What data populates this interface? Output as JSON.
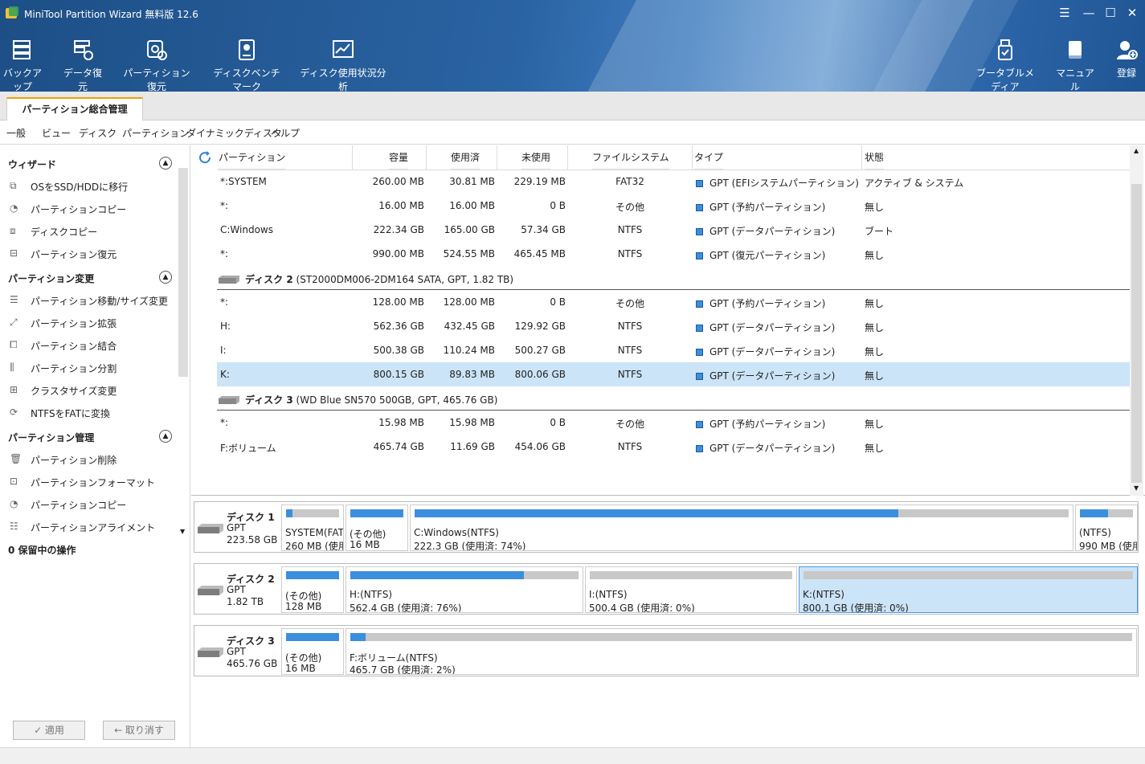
{
  "app": {
    "title": "MiniTool Partition Wizard 無料版 12.6"
  },
  "window_controls": {
    "menu": "☰",
    "minimize": "—",
    "maximize": "☐",
    "close": "✕"
  },
  "toolbar": {
    "left": [
      {
        "label": "バックアップ",
        "icon": "backup-icon"
      },
      {
        "label": "データ復元",
        "icon": "data-recovery-icon"
      },
      {
        "label": "パーティション復元",
        "icon": "partition-recovery-icon"
      },
      {
        "label": "ディスクベンチマーク",
        "icon": "disk-benchmark-icon"
      },
      {
        "label": "ディスク使用状況分析",
        "icon": "disk-usage-icon"
      }
    ],
    "right": [
      {
        "label": "ブータブルメディア",
        "icon": "bootable-media-icon"
      },
      {
        "label": "マニュアル",
        "icon": "manual-icon"
      },
      {
        "label": "登録",
        "icon": "register-icon"
      }
    ]
  },
  "tab": {
    "label": "パーティション総合管理"
  },
  "menu": [
    "一般",
    "ビュー",
    "ディスク",
    "パーティション",
    "ダイナミックディスク",
    "ヘルプ"
  ],
  "sidebar": {
    "sections": [
      {
        "title": "ウィザード",
        "items": [
          "OSをSSD/HDDに移行",
          "パーティションコピー",
          "ディスクコピー",
          "パーティション復元"
        ]
      },
      {
        "title": "パーティション変更",
        "items": [
          "パーティション移動/サイズ変更",
          "パーティション拡張",
          "パーティション結合",
          "パーティション分割",
          "クラスタサイズ変更",
          "NTFSをFATに変換"
        ]
      },
      {
        "title": "パーティション管理",
        "items": [
          "パーティション削除",
          "パーティションフォーマット",
          "パーティションコピー",
          "パーティションアライメント"
        ]
      }
    ],
    "pending": "0 保留中の操作",
    "apply": "✓ 適用",
    "undo": "← 取り消す"
  },
  "table": {
    "headers": [
      "パーティション",
      "容量",
      "使用済",
      "未使用",
      "ファイルシステム",
      "タイプ",
      "状態"
    ],
    "rows": [
      {
        "kind": "part",
        "name": "*:SYSTEM",
        "cap": "260.00 MB",
        "used": "30.81 MB",
        "free": "229.19 MB",
        "fs": "FAT32",
        "type": "GPT (EFIシステムパーティション)",
        "status": "アクティブ & システム"
      },
      {
        "kind": "part",
        "name": "*:",
        "cap": "16.00 MB",
        "used": "16.00 MB",
        "free": "0 B",
        "fs": "その他",
        "type": "GPT (予約パーティション)",
        "status": "無し"
      },
      {
        "kind": "part",
        "name": "C:Windows",
        "cap": "222.34 GB",
        "used": "165.00 GB",
        "free": "57.34 GB",
        "fs": "NTFS",
        "type": "GPT (データパーティション)",
        "status": "ブート"
      },
      {
        "kind": "part",
        "name": "*:",
        "cap": "990.00 MB",
        "used": "524.55 MB",
        "free": "465.45 MB",
        "fs": "NTFS",
        "type": "GPT (復元パーティション)",
        "status": "無し"
      },
      {
        "kind": "disk",
        "label": "ディスク 2",
        "detail": "(ST2000DM006-2DM164 SATA, GPT, 1.82 TB)"
      },
      {
        "kind": "part",
        "name": "*:",
        "cap": "128.00 MB",
        "used": "128.00 MB",
        "free": "0 B",
        "fs": "その他",
        "type": "GPT (予約パーティション)",
        "status": "無し"
      },
      {
        "kind": "part",
        "name": "H:",
        "cap": "562.36 GB",
        "used": "432.45 GB",
        "free": "129.92 GB",
        "fs": "NTFS",
        "type": "GPT (データパーティション)",
        "status": "無し"
      },
      {
        "kind": "part",
        "name": "I:",
        "cap": "500.38 GB",
        "used": "110.24 MB",
        "free": "500.27 GB",
        "fs": "NTFS",
        "type": "GPT (データパーティション)",
        "status": "無し"
      },
      {
        "kind": "part",
        "name": "K:",
        "cap": "800.15 GB",
        "used": "89.83 MB",
        "free": "800.06 GB",
        "fs": "NTFS",
        "type": "GPT (データパーティション)",
        "status": "無し",
        "selected": true
      },
      {
        "kind": "disk",
        "label": "ディスク 3",
        "detail": "(WD Blue SN570 500GB, GPT, 465.76 GB)"
      },
      {
        "kind": "part",
        "name": "*:",
        "cap": "15.98 MB",
        "used": "15.98 MB",
        "free": "0 B",
        "fs": "その他",
        "type": "GPT (予約パーティション)",
        "status": "無し"
      },
      {
        "kind": "part",
        "name": "F:ボリューム",
        "cap": "465.74 GB",
        "used": "11.69 GB",
        "free": "454.06 GB",
        "fs": "NTFS",
        "type": "GPT (データパーティション)",
        "status": "無し"
      }
    ]
  },
  "disks": [
    {
      "name": "ディスク 1",
      "type": "GPT",
      "size": "223.58 GB",
      "parts": [
        {
          "l1": "SYSTEM(FAT3",
          "l2": "260 MB (使用",
          "fill": 0.12
        },
        {
          "l1": "(その他)",
          "l2": "16 MB",
          "fill": 1.0
        },
        {
          "l1": "C:Windows(NTFS)",
          "l2": "222.3 GB (使用済: 74%)",
          "fill": 0.74
        },
        {
          "l1": "(NTFS)",
          "l2": "990 MB (使用",
          "fill": 0.53
        }
      ]
    },
    {
      "name": "ディスク 2",
      "type": "GPT",
      "size": "1.82 TB",
      "parts": [
        {
          "l1": "(その他)",
          "l2": "128 MB",
          "fill": 1.0
        },
        {
          "l1": "H:(NTFS)",
          "l2": "562.4 GB (使用済: 76%)",
          "fill": 0.76
        },
        {
          "l1": "I:(NTFS)",
          "l2": "500.4 GB (使用済: 0%)",
          "fill": 0.0
        },
        {
          "l1": "K:(NTFS)",
          "l2": "800.1 GB (使用済: 0%)",
          "fill": 0.0,
          "selected": true
        }
      ]
    },
    {
      "name": "ディスク 3",
      "type": "GPT",
      "size": "465.76 GB",
      "parts": [
        {
          "l1": "(その他)",
          "l2": "16 MB",
          "fill": 1.0
        },
        {
          "l1": "F:ボリューム(NTFS)",
          "l2": "465.7 GB (使用済: 2%)",
          "fill": 0.02
        }
      ]
    }
  ]
}
